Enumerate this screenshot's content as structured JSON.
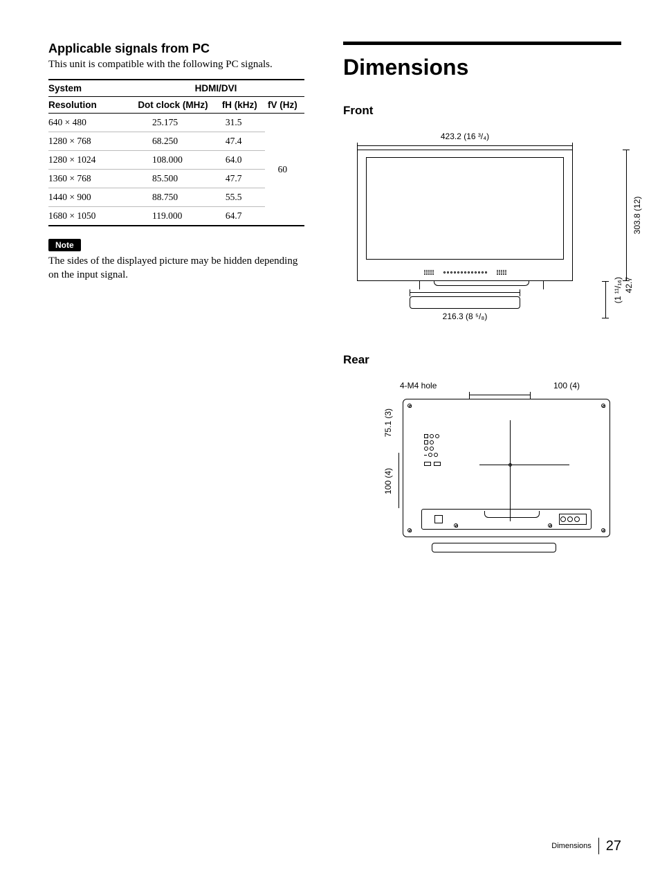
{
  "left": {
    "heading": "Applicable signals from PC",
    "intro": "This unit is compatible with the following PC signals.",
    "table": {
      "header_system": "System",
      "header_hdmi": "HDMI/DVI",
      "header_resolution": "Resolution",
      "header_dotclock": "Dot clock (MHz)",
      "header_fh": "fH (kHz)",
      "header_fv": "fV (Hz)",
      "fv_shared": "60",
      "rows": [
        {
          "res": "640 × 480",
          "dot": "25.175",
          "fh": "31.5"
        },
        {
          "res": "1280 × 768",
          "dot": "68.250",
          "fh": "47.4"
        },
        {
          "res": "1280 × 1024",
          "dot": "108.000",
          "fh": "64.0"
        },
        {
          "res": "1360 × 768",
          "dot": "85.500",
          "fh": "47.7"
        },
        {
          "res": "1440 × 900",
          "dot": "88.750",
          "fh": "55.5"
        },
        {
          "res": "1680 × 1050",
          "dot": "119.000",
          "fh": "64.7"
        }
      ]
    },
    "note_label": "Note",
    "note_text": "The sides of the displayed picture may be hidden depending on the input signal."
  },
  "right": {
    "title": "Dimensions",
    "front_heading": "Front",
    "front": {
      "width": "423.2 (16 ³/₄)",
      "height": "303.8 (12)",
      "base_width": "216.3 (8 ⁵/₈)",
      "stand_height_top": "42.7",
      "stand_height_bottom": "(1 ¹¹/₁₆)"
    },
    "rear_heading": "Rear",
    "rear": {
      "hole_label": "4-M4 hole",
      "spacing_h": "100 (4)",
      "top_offset": "75.1 (3)",
      "spacing_v": "100 (4)"
    }
  },
  "footer": {
    "section": "Dimensions",
    "page": "27"
  }
}
